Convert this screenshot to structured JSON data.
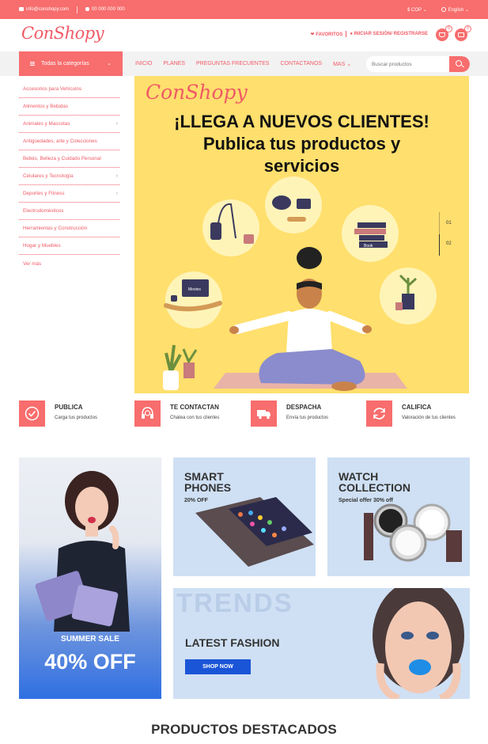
{
  "topbar": {
    "email": "info@conshopy.com",
    "phone": "00 000 000 000",
    "currency": "$ COP",
    "language": "English"
  },
  "header": {
    "logo": "ConShopy",
    "favorites": "FAVORITOS",
    "login": "INICIAR SESIÓN/ REGISTRARSE",
    "cart_count": "0",
    "compare_count": "0"
  },
  "nav": {
    "categories_button": "Todas la categorías",
    "menu": [
      "INICIO",
      "PLANES",
      "PREGUNTAS FRECUENTES",
      "CONTACTANOS",
      "MAS"
    ],
    "search_placeholder": "Buscar productos"
  },
  "sidebar": {
    "items": [
      {
        "label": "Accesorios para Vehículos",
        "has_sub": false
      },
      {
        "label": "Alimentos y Bebidas",
        "has_sub": false
      },
      {
        "label": "Animales y Mascotas",
        "has_sub": true
      },
      {
        "label": "Antigüedades, arte y Colecciones",
        "has_sub": false
      },
      {
        "label": "Bebés, Belleza y Cuidado Personal",
        "has_sub": false
      },
      {
        "label": "Celulares y Tecnología",
        "has_sub": true
      },
      {
        "label": "Deportes y Fitness",
        "has_sub": true
      },
      {
        "label": "Electrodomésticos",
        "has_sub": false
      },
      {
        "label": "Herramientas y Construcción",
        "has_sub": false
      },
      {
        "label": "Hogar y Muebles",
        "has_sub": false
      }
    ],
    "more": "Ver más"
  },
  "hero": {
    "logo": "ConShopy",
    "line1": "¡LLEGA A NUEVOS CLIENTES!",
    "line2": "Publica tus productos y",
    "line3": "servicios",
    "slides": [
      "01",
      "02"
    ],
    "book_label": "Book",
    "laptop_label": "Movies"
  },
  "features": [
    {
      "title": "PUBLICA",
      "subtitle": "Carga tus productos",
      "icon": "check-circle-icon"
    },
    {
      "title": "TE CONTACTAN",
      "subtitle": "Chatea con tus clientes",
      "icon": "headset-icon"
    },
    {
      "title": "DESPACHA",
      "subtitle": "Envía tus productos",
      "icon": "truck-icon"
    },
    {
      "title": "CALIFICA",
      "subtitle": "Valoración de tus clientes",
      "icon": "refresh-icon"
    }
  ],
  "banners": {
    "summer": {
      "title": "SUMMER SALE",
      "offer": "40% OFF"
    },
    "phones": {
      "title1": "SMART",
      "title2": "PHONES",
      "offer": "20% OFF"
    },
    "watch": {
      "title1": "WATCH",
      "title2": "COLLECTION",
      "offer": "Special offer 30% off"
    },
    "trends": {
      "bg_word": "TRENDS",
      "title": "LATEST FASHION",
      "button": "SHOP NOW"
    }
  },
  "section_title": "PRODUCTOS DESTACADOS",
  "colors": {
    "accent": "#f86d6d",
    "hero_bg": "#ffdf6d",
    "banner_bg": "#cfe0f4",
    "shop_button": "#1a55d8"
  }
}
